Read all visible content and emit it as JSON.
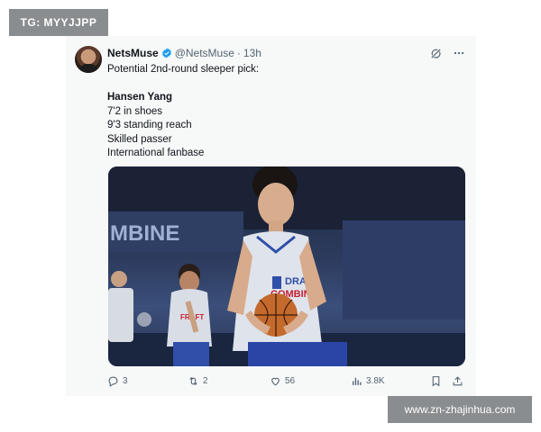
{
  "watermarks": {
    "top": "TG: MYYJJPP",
    "bottom": "www.zn-zhajinhua.com"
  },
  "tweet": {
    "author_name": "NetsMuse",
    "handle": "@NetsMuse",
    "separator": "·",
    "time": "13h",
    "lines": [
      "Potential 2nd-round sleeper pick:",
      "",
      "Hansen Yang",
      "7'2 in shoes",
      "9'3 standing reach",
      "Skilled passer",
      "International fanbase"
    ],
    "photo": {
      "banner_text": "MBINE",
      "jersey_text_1": "DRAFT",
      "jersey_text_2": "COMBINE"
    },
    "actions": {
      "replies": "3",
      "retweets": "2",
      "likes": "56",
      "views": "3.8K"
    },
    "icons": [
      "verified-icon",
      "grok-icon",
      "more-icon",
      "reply-icon",
      "retweet-icon",
      "like-icon",
      "views-icon",
      "bookmark-icon",
      "share-icon"
    ]
  },
  "colors": {
    "card_bg": "#f7f9f9",
    "text": "#0f1419",
    "secondary": "#536471",
    "verified": "#1d9bf0",
    "watermark_bg": "#8a8d90"
  }
}
